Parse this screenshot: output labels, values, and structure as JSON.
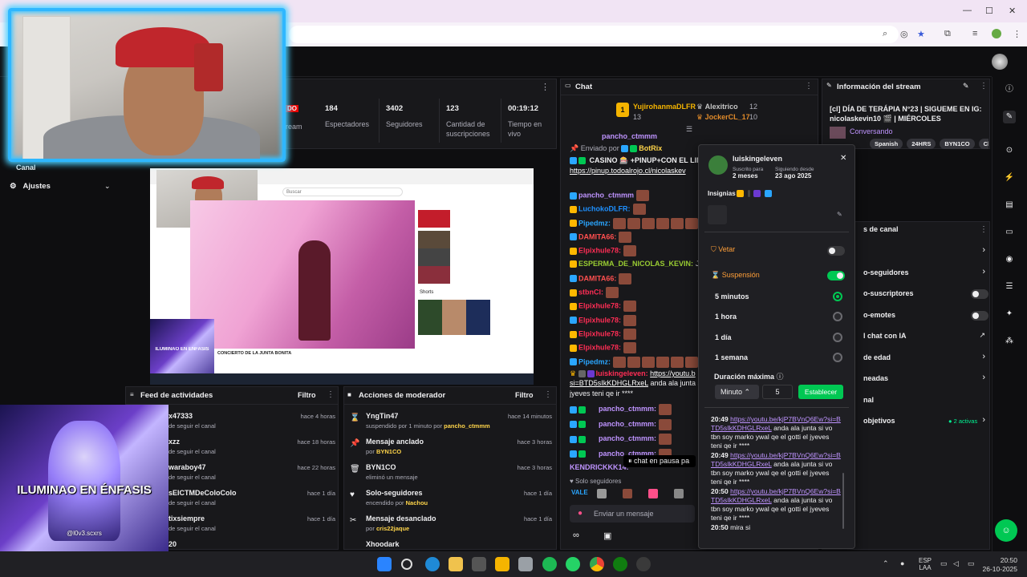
{
  "browser": {
    "window_controls": [
      "—",
      "☐",
      "✕"
    ]
  },
  "stats": [
    {
      "num": "184",
      "label": "Espectadores"
    },
    {
      "num": "3402",
      "label": "Seguidores"
    },
    {
      "num": "123",
      "label": "Cantidad de suscripciones"
    },
    {
      "num": "00:19:12",
      "label": "Tiempo en vivo"
    }
  ],
  "live_partial": {
    "badge": "DO",
    "label": "ream"
  },
  "left_nav": {
    "channel": "Canal",
    "settings": "Ajustes"
  },
  "overlay_text": "ILUMINAO EN ÉNFASIS",
  "overlay_handle": "@l0v3.scxrs",
  "preview_overlay_text": "ILUMINAO EN ÉNFASIS",
  "preview_caption": "CONCIERTO DE LA JUNTA BONITA",
  "preview_search": "Buscar",
  "preview_shorts": "Shorts",
  "feed": {
    "title": "Feed de actividades",
    "filter": "Filtro",
    "items": [
      {
        "user": "x47333",
        "sub": "de seguir el canal",
        "time": "hace 4 horas"
      },
      {
        "user": "xzz",
        "sub": "de seguir el canal",
        "time": "hace 18 horas"
      },
      {
        "user": "waraboy47",
        "sub": "de seguir el canal",
        "time": "hace 22 horas"
      },
      {
        "user": "sEICTMDeColoColo",
        "sub": "de seguir el canal",
        "time": "hace 1 día"
      },
      {
        "user": "tixsiempre",
        "sub": "de seguir el canal",
        "time": "hace 1 día"
      },
      {
        "user": "20",
        "sub": "",
        "time": ""
      }
    ]
  },
  "modactions": {
    "title": "Acciones de moderador",
    "filter": "Filtro",
    "items": [
      {
        "icon": "⌛",
        "title": "YngTin47",
        "sub": "suspendido por 1 minuto por ",
        "by": "pancho_ctmmm",
        "time": "hace 14 minutos"
      },
      {
        "icon": "📌",
        "title": "Mensaje anclado",
        "sub": "por ",
        "by": "BYN1CO",
        "time": "hace 3 horas"
      },
      {
        "icon": "🗑",
        "title": "BYN1CO",
        "sub": "eliminó un mensaje",
        "by": "",
        "time": "hace 3 horas"
      },
      {
        "icon": "♥",
        "title": "Solo-seguidores",
        "sub": "encendido por ",
        "by": "Nachou",
        "time": "hace 1 día"
      },
      {
        "icon": "✂",
        "title": "Mensaje desanclado",
        "sub": "por ",
        "by": "cris22jaque",
        "time": "hace 1 día"
      },
      {
        "icon": "",
        "title": "Xhoodark",
        "sub": "",
        "by": "",
        "time": ""
      }
    ]
  },
  "chat": {
    "title": "Chat",
    "leaders": [
      {
        "name": "YujirohanmaDLFR",
        "count": "13"
      },
      {
        "name": "Alexitrico",
        "count": "12"
      },
      {
        "name": "JockerCL_17",
        "count": "10"
      }
    ],
    "partial_top": "pancho_ctmmm",
    "pinned_by": "Enviado por",
    "pinned_user": "BotRix",
    "pinned_text": "CASINO 🎰 +PINUP+CON EL LIN",
    "pinned_link": "https://pinup.todoalrojo.cl/nicolaskev",
    "lines": [
      {
        "user": "pancho_ctmmm",
        "color": "#bf94ff",
        "emotes": 1
      },
      {
        "user": "LuchokoDLFR:",
        "color": "#1e90ff",
        "emotes": 1
      },
      {
        "user": "Pipedmz:",
        "color": "#2aa6ff",
        "emotes": 6
      },
      {
        "user": "DAMITA66:",
        "color": "#ff4f4f",
        "emotes": 1
      },
      {
        "user": "Elpixhule78:",
        "color": "#ff2d55",
        "emotes": 1
      },
      {
        "user": "ESPERMA_DE_NICOLAS_KEVIN:",
        "color": "#9acd32",
        "text": "JAJAJA"
      },
      {
        "user": "DAMITA66:",
        "color": "#ff4f4f",
        "emotes": 1
      },
      {
        "user": "stbnCl:",
        "color": "#ff2d55",
        "emotes": 1
      },
      {
        "user": "Elpixhule78:",
        "color": "#ff2d55",
        "emotes": 1
      },
      {
        "user": "Elpixhule78:",
        "color": "#ff2d55",
        "emotes": 1
      },
      {
        "user": "Elpixhule78:",
        "color": "#ff2d55",
        "emotes": 1
      },
      {
        "user": "Elpixhule78:",
        "color": "#ff2d55",
        "emotes": 1
      },
      {
        "user": "Pipedmz:",
        "color": "#2aa6ff",
        "emotes": 6
      }
    ],
    "yt_user": "luiskingeleven:",
    "yt_link": "https://youtu.b",
    "yt_link2": "si=BTD5sIkKDHGLRxeL",
    "yt_text": "anda ala junta si",
    "yt_text2": "jyeves teni qe ir ****",
    "pancho_lines": [
      "pancho_ctmmm:",
      "pancho_ctmmm:",
      "pancho_ctmmm:",
      "pancho_ctmmm:"
    ],
    "kendrick": "KENDRICKKK14:",
    "paused": "chat en pausa pa",
    "follower_only": "Solo seguidores",
    "input_placeholder": "Enviar un mensaje"
  },
  "stream_info": {
    "title": "Información del stream",
    "stream_title": "[cl] DÍA DE TERÁPIA N°23 | SIGUEME EN IG: nicolaskevin10 🎬 | MIÉRCOLES FUMISTREA...",
    "category": "Conversando",
    "tags": [
      "Spanish",
      "24HRS",
      "BYN1CO",
      "Chile"
    ]
  },
  "settings_panel": {
    "title": "s de canal",
    "rows": [
      {
        "label": "",
        "control": "chevron"
      },
      {
        "label": "o-seguidores",
        "control": "chevron"
      },
      {
        "label": "o-suscriptores",
        "control": "toggle"
      },
      {
        "label": "o-emotes",
        "control": "toggle"
      },
      {
        "label": "l chat con IA",
        "control": "external"
      },
      {
        "label": "de edad",
        "control": "chevron"
      },
      {
        "label": "neadas",
        "control": "chevron"
      },
      {
        "label": "nal",
        "control": ""
      },
      {
        "label": "objetivos",
        "control": "chevron",
        "extra": "● 2 activas"
      }
    ]
  },
  "user_card": {
    "username": "luiskingeleven",
    "subscribed_label": "Suscrito para",
    "subscribed_value": "2 meses",
    "following_label": "Siguiendo desde",
    "following_value": "23 ago 2025",
    "badges_label": "Insignias",
    "ban_label": "Vetar",
    "timeout_label": "Suspensión",
    "options": [
      {
        "label": "5 minutos",
        "selected": true
      },
      {
        "label": "1 hora",
        "selected": false
      },
      {
        "label": "1 día",
        "selected": false
      },
      {
        "label": "1 semana",
        "selected": false
      }
    ],
    "max_label": "Duración máxima",
    "unit": "Minuto",
    "value": "5",
    "set_button": "Establecer",
    "messages": [
      {
        "time": "20:49",
        "link": "https://youtu.be/kjP7BVnQ6Ew?si=BTD5sIkKDHGLRxeL",
        "text": "anda ala junta si vo tbn soy marko ywal qe el gotti el jyeves teni qe ir ****"
      },
      {
        "time": "20:49",
        "link": "https://youtu.be/kjP7BVnQ6Ew?si=BTD5sIkKDHGLRxeL",
        "text": "anda ala junta si vo tbn soy marko ywal qe el gotti el jyeves teni qe ir ****"
      },
      {
        "time": "20:50",
        "link": "https://youtu.be/kjP7BVnQ6Ew?si=BTD5sIkKDHGLRxeL",
        "text": "anda ala junta si vo tbn soy marko ywal qe el gotti el jyeves teni qe ir ****"
      },
      {
        "time": "20:50",
        "link": "",
        "text": "mira si"
      }
    ]
  },
  "taskbar": {
    "lang1": "ESP",
    "lang2": "LAA",
    "time": "20:50",
    "date": "26-10-2025"
  },
  "colors": {
    "accent": "#9147ff",
    "green": "#00c853",
    "webcam_border": "#2fb7ff"
  }
}
